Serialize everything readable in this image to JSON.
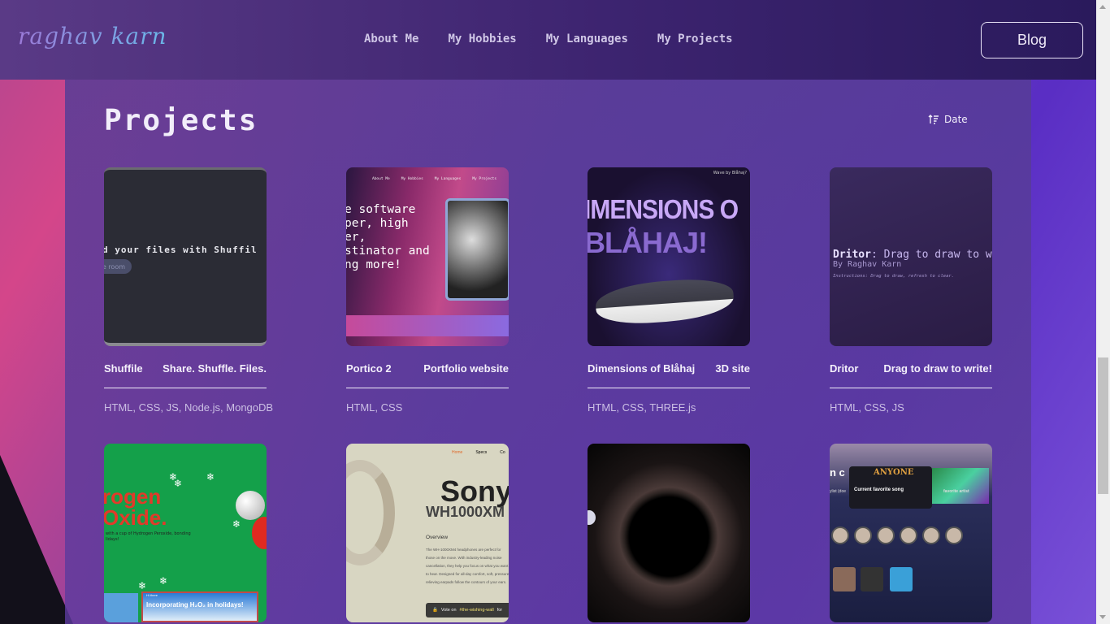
{
  "header": {
    "logo_text": "raghav karn",
    "nav": [
      {
        "label": "About Me"
      },
      {
        "label": "My Hobbies"
      },
      {
        "label": "My Languages"
      },
      {
        "label": "My Projects"
      }
    ],
    "blog_label": "Blog"
  },
  "main": {
    "title": "Projects",
    "sort_label": "Date",
    "sort_icon": "sort-ascending-icon"
  },
  "projects": [
    {
      "name": "Shuffile",
      "tagline": "Share. Shuffle. Files.",
      "tech": "HTML, CSS, JS, Node.js, MongoDB",
      "preview": {
        "headline": "d your files with Shuffil",
        "button": "te room"
      }
    },
    {
      "name": "Portico 2",
      "tagline": "Portfolio website",
      "tech": "HTML, CSS",
      "preview": {
        "nav": [
          "About Me",
          "My Hobbies",
          "My Languages",
          "My Projects"
        ],
        "headline": "e software\nper, high\ner,\nstinator and\nng more!"
      }
    },
    {
      "name": "Dimensions of Blåhaj",
      "tagline": "3D site",
      "tech": "HTML, CSS, THREE.js",
      "preview": {
        "line1": "IMENSIONS O",
        "line2": "BLÅHAJ!",
        "corner": "Wave by Blåhaj?"
      }
    },
    {
      "name": "Dritor",
      "tagline": "Drag to draw to write!",
      "tech": "HTML, CSS, JS",
      "preview": {
        "app": "Dritor",
        "headline": ": Drag to draw to wri",
        "byline": "By Raghav Karn",
        "instructions": "Instructions: Drag to draw, refresh to clear."
      }
    },
    {
      "name": "",
      "tagline": "",
      "tech": "",
      "preview": {
        "line1": "rogen",
        "line2": "Oxide.",
        "sub": "with a cup of Hydrogen Peroxide, bonding\nlidays!",
        "banner": "Incorporating H₂O₂ in holidays!",
        "banner_tag": "Hi there"
      }
    },
    {
      "name": "",
      "tagline": "",
      "tech": "",
      "preview": {
        "nav": [
          "Home",
          "Specs",
          "Co"
        ],
        "title": "Sony",
        "model": "WH1000XM",
        "overview": "Overview",
        "body": "The WH-1000XM4 headphones are perfect for those on the move. With industry-leading noise cancellation, they help you focus on what you want to hear. Designed for all-day comfort, soft, pressure-relieving earpads follow the contours of your ears.",
        "vote_prefix": "Vote on",
        "vote_link": "#the-wishing-wall",
        "vote_suffix": "for"
      }
    },
    {
      "name": "",
      "tagline": "",
      "tech": "",
      "preview": {}
    },
    {
      "name": "",
      "tagline": "",
      "tech": "",
      "preview": {
        "album": "ANYONE",
        "current": "Current favorite song",
        "left": "n c",
        "sub_left": "ylist (doe",
        "right": "favorite artist"
      }
    }
  ],
  "colors": {
    "accent": "#5a2ec4",
    "panel": "#563c96",
    "text": "#f2eefa"
  }
}
